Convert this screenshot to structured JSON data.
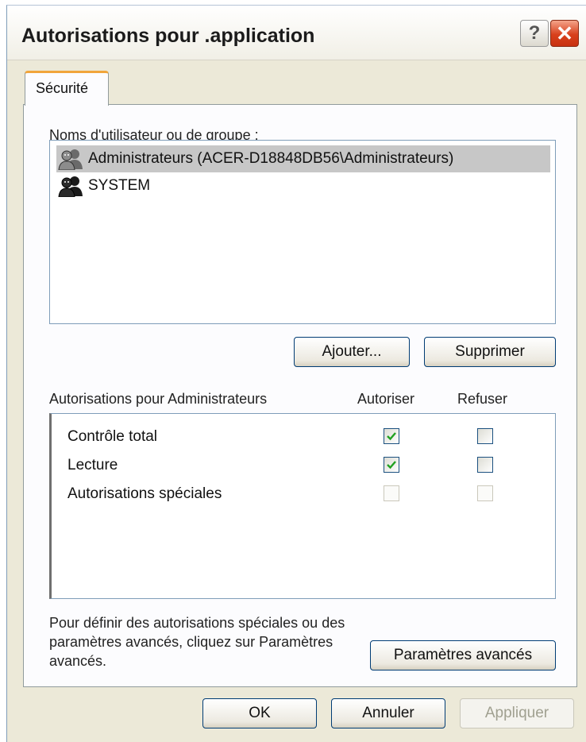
{
  "window": {
    "title": "Autorisations pour .application",
    "help_glyph": "?",
    "close_glyph": "✕"
  },
  "tabs": [
    {
      "label": "Sécurité",
      "active": true
    }
  ],
  "users": {
    "label": "Noms d'utilisateur ou de groupe :",
    "items": [
      {
        "name": "Administrateurs (ACER-D18848DB56\\Administrateurs)",
        "selected": true,
        "icon": "users-group-icon"
      },
      {
        "name": "SYSTEM",
        "selected": false,
        "icon": "users-group-icon"
      }
    ],
    "add_label": "Ajouter...",
    "remove_label": "Supprimer"
  },
  "permissions": {
    "label": "Autorisations pour Administrateurs",
    "allow_header": "Autoriser",
    "deny_header": "Refuser",
    "rows": [
      {
        "name": "Contrôle total",
        "allow": true,
        "deny": false,
        "enabled": true
      },
      {
        "name": "Lecture",
        "allow": true,
        "deny": false,
        "enabled": true
      },
      {
        "name": "Autorisations spéciales",
        "allow": false,
        "deny": false,
        "enabled": false
      }
    ]
  },
  "advanced": {
    "help_text": "Pour définir des autorisations spéciales ou des paramètres avancés, cliquez sur Paramètres avancés.",
    "button_label": "Paramètres avancés"
  },
  "footer": {
    "ok_label": "OK",
    "cancel_label": "Annuler",
    "apply_label": "Appliquer"
  },
  "colors": {
    "check_mark": "#21a121",
    "close_button": "#d8401c",
    "tab_highlight": "#f1a53b",
    "selection": "#c7c7c7"
  }
}
